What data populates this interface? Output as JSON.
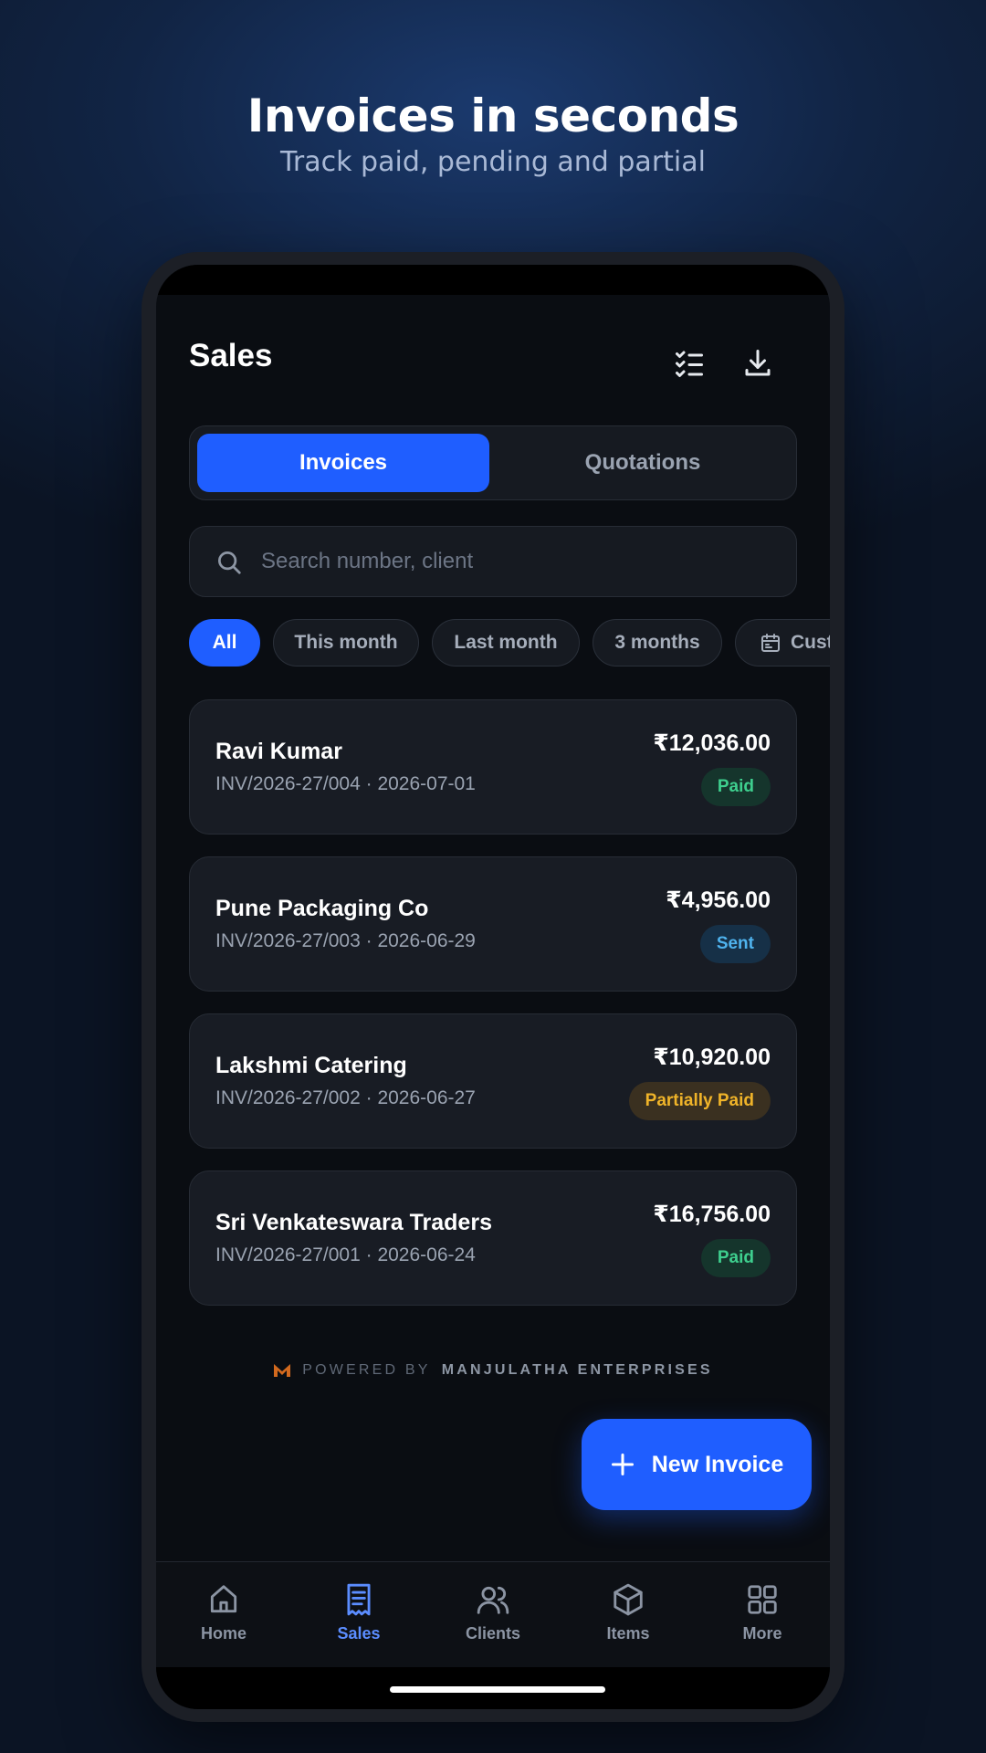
{
  "promo": {
    "headline": "Invoices in seconds",
    "subheadline": "Track paid, pending and partial"
  },
  "header": {
    "title": "Sales",
    "actions": [
      {
        "icon": "checklist-icon"
      },
      {
        "icon": "download-icon"
      }
    ]
  },
  "tabs": [
    {
      "label": "Invoices",
      "active": true
    },
    {
      "label": "Quotations",
      "active": false
    }
  ],
  "search": {
    "placeholder": "Search number, client",
    "value": ""
  },
  "filters": [
    {
      "label": "All",
      "active": true
    },
    {
      "label": "This month",
      "active": false
    },
    {
      "label": "Last month",
      "active": false
    },
    {
      "label": "3 months",
      "active": false
    },
    {
      "label": "Custom",
      "icon": "calendar-icon",
      "active": false
    }
  ],
  "invoices": [
    {
      "client": "Ravi Kumar",
      "meta": "INV/2026-27/004 · 2026-07-01",
      "amount": "₹12,036.00",
      "status": "Paid"
    },
    {
      "client": "Pune Packaging Co",
      "meta": "INV/2026-27/003 · 2026-06-29",
      "amount": "₹4,956.00",
      "status": "Sent"
    },
    {
      "client": "Lakshmi Catering",
      "meta": "INV/2026-27/002 · 2026-06-27",
      "amount": "₹10,920.00",
      "status": "Partially Paid"
    },
    {
      "client": "Sri Venkateswara Traders",
      "meta": "INV/2026-27/001 · 2026-06-24",
      "amount": "₹16,756.00",
      "status": "Paid"
    }
  ],
  "status_colors": {
    "Paid": {
      "bg": "#15352c",
      "fg": "#3ecf8e"
    },
    "Sent": {
      "bg": "#163047",
      "fg": "#4fb3ee"
    },
    "Partially Paid": {
      "bg": "#3a3020",
      "fg": "#f0b429"
    }
  },
  "footer": {
    "powered_prefix": "POWERED BY",
    "powered_brand": "MANJULATHA ENTERPRISES",
    "logo_color": "#d2691e"
  },
  "fab": {
    "label": "New Invoice",
    "icon": "plus-icon"
  },
  "bottom_nav": [
    {
      "label": "Home",
      "icon": "home-icon",
      "active": false
    },
    {
      "label": "Sales",
      "icon": "receipt-icon",
      "active": true
    },
    {
      "label": "Clients",
      "icon": "users-icon",
      "active": false
    },
    {
      "label": "Items",
      "icon": "box-icon",
      "active": false
    },
    {
      "label": "More",
      "icon": "grid-icon",
      "active": false
    }
  ],
  "colors": {
    "accent": "#1f5eff",
    "nav_active": "#5b8dff"
  }
}
